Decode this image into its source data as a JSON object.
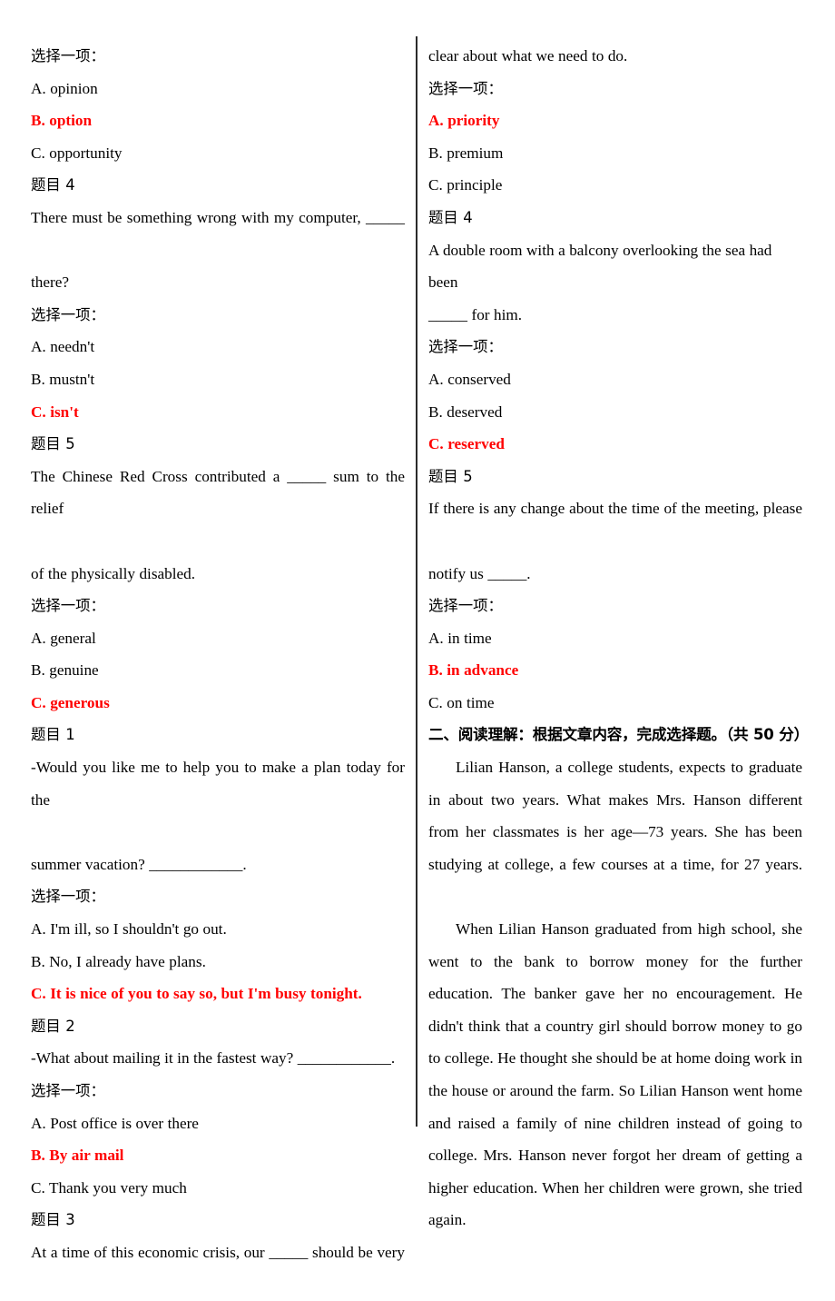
{
  "document": {
    "type": "exam-paper",
    "columns": 2,
    "answer_color": "#ff0000",
    "body_color": "#000000"
  },
  "labels": {
    "choose_one": "选择一项：",
    "question_prefix": "题目"
  },
  "left_column": {
    "blocks": [
      {
        "kind": "prompt_label",
        "text": "选择一项："
      },
      {
        "kind": "option",
        "text": "A. opinion",
        "correct": false
      },
      {
        "kind": "option",
        "text": "B. option",
        "correct": true
      },
      {
        "kind": "option",
        "text": "C. opportunity",
        "correct": false
      },
      {
        "kind": "question_number",
        "text": "题目 4"
      },
      {
        "kind": "stem_line1",
        "text": "There must be something wrong with my computer, _____"
      },
      {
        "kind": "stem_line2",
        "text": "there?"
      },
      {
        "kind": "prompt_label",
        "text": "选择一项："
      },
      {
        "kind": "option",
        "text": "A. needn't",
        "correct": false
      },
      {
        "kind": "option",
        "text": "B. mustn't",
        "correct": false
      },
      {
        "kind": "option",
        "text": "C. isn't",
        "correct": true
      },
      {
        "kind": "question_number",
        "text": "题目 5"
      },
      {
        "kind": "stem_line1",
        "text": "The Chinese Red Cross contributed a _____ sum to the relief"
      },
      {
        "kind": "stem_line2",
        "text": "of the physically disabled."
      },
      {
        "kind": "prompt_label",
        "text": "选择一项："
      },
      {
        "kind": "option",
        "text": "A. general",
        "correct": false
      },
      {
        "kind": "option",
        "text": "B. genuine",
        "correct": false
      },
      {
        "kind": "option",
        "text": "C. generous",
        "correct": true
      },
      {
        "kind": "question_number",
        "text": "题目 1"
      },
      {
        "kind": "stem_line1",
        "text": "-Would you like me to help you to make a plan today for the"
      },
      {
        "kind": "stem_line2",
        "text": "summer vacation? ____________."
      },
      {
        "kind": "prompt_label",
        "text": "选择一项："
      },
      {
        "kind": "option",
        "text": "A. I'm ill, so I shouldn't go out.",
        "correct": false
      },
      {
        "kind": "option",
        "text": "B. No, I already have plans.",
        "correct": false
      },
      {
        "kind": "option",
        "text": "C. It is nice of you to say so, but I'm busy tonight.",
        "correct": true
      },
      {
        "kind": "question_number",
        "text": "题目 2"
      },
      {
        "kind": "stem_line2",
        "text": "-What about mailing it in the fastest way? ____________."
      },
      {
        "kind": "prompt_label",
        "text": "选择一项："
      },
      {
        "kind": "option",
        "text": "A. Post office is over there",
        "correct": false
      },
      {
        "kind": "option",
        "text": "B. By air mail",
        "correct": true
      },
      {
        "kind": "option",
        "text": "C. Thank you very much",
        "correct": false
      },
      {
        "kind": "question_number",
        "text": "题目 3"
      },
      {
        "kind": "stem_line1",
        "text": "At a time of this economic crisis, our _____ should be very"
      }
    ]
  },
  "right_column": {
    "blocks": [
      {
        "kind": "stem_line2",
        "text": "clear about what we need to do."
      },
      {
        "kind": "prompt_label",
        "text": "选择一项："
      },
      {
        "kind": "option",
        "text": "A. priority",
        "correct": true
      },
      {
        "kind": "option",
        "text": "B. premium",
        "correct": false
      },
      {
        "kind": "option",
        "text": "C. principle",
        "correct": false
      },
      {
        "kind": "question_number",
        "text": "题目 4"
      },
      {
        "kind": "stem_line1",
        "text": "A double room with a balcony overlooking the sea had been"
      },
      {
        "kind": "stem_line2",
        "text": "_____ for him."
      },
      {
        "kind": "prompt_label",
        "text": "选择一项："
      },
      {
        "kind": "option",
        "text": "A. conserved",
        "correct": false
      },
      {
        "kind": "option",
        "text": "B. deserved",
        "correct": false
      },
      {
        "kind": "option",
        "text": "C. reserved",
        "correct": true
      },
      {
        "kind": "question_number",
        "text": "题目 5"
      },
      {
        "kind": "stem_line1",
        "text": "If there is any change about the time of the meeting, please"
      },
      {
        "kind": "stem_line2",
        "text": "notify us _____."
      },
      {
        "kind": "prompt_label",
        "text": "选择一项："
      },
      {
        "kind": "option",
        "text": "A. in time",
        "correct": false
      },
      {
        "kind": "option",
        "text": "B. in advance",
        "correct": true
      },
      {
        "kind": "option",
        "text": "C. on time",
        "correct": false
      }
    ],
    "section_heading": "二、阅读理解：根据文章内容，完成选择题。（共 50 分）",
    "passage_paragraphs": [
      "Lilian Hanson, a college students, expects to graduate in about two years. What makes Mrs. Hanson different from her classmates is her age—73 years. She has been studying at college, a few courses at a time, for 27 years.",
      "When Lilian Hanson graduated from high school, she went to the bank to borrow money for the further education. The banker gave her no encouragement. He didn't think that a country girl should borrow money to go to college. He thought she should be at home doing work in the house or around the farm. So Lilian Hanson went home and raised a family of nine children instead of going to college. Mrs. Hanson never forgot her dream of getting a higher education. When her children were grown, she tried again."
    ]
  }
}
